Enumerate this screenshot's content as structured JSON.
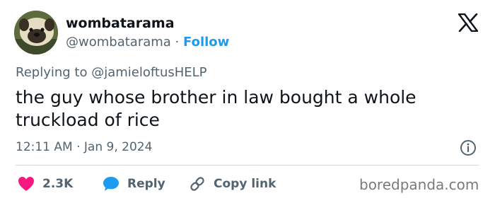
{
  "author": {
    "display_name": "wombatarama",
    "handle": "@wombatarama",
    "separator": "·",
    "follow_label": "Follow"
  },
  "reply_context": {
    "prefix": "Replying to",
    "mention": "@jamieloftusHELP"
  },
  "tweet": {
    "text": "the guy whose brother in law bought a whole truckload of rice",
    "timestamp": "12:11 AM · Jan 9, 2024"
  },
  "actions": {
    "like_count": "2.3K",
    "reply_label": "Reply",
    "copy_link_label": "Copy link"
  },
  "watermark": "boredpanda.com",
  "icons": {
    "platform": "x-logo-icon",
    "info": "info-icon",
    "like": "heart-icon",
    "reply": "speech-bubble-icon",
    "copy": "link-icon"
  },
  "colors": {
    "accent": "#1d9bf0",
    "like": "#f91880",
    "text": "#0f1419",
    "muted": "#536471"
  }
}
